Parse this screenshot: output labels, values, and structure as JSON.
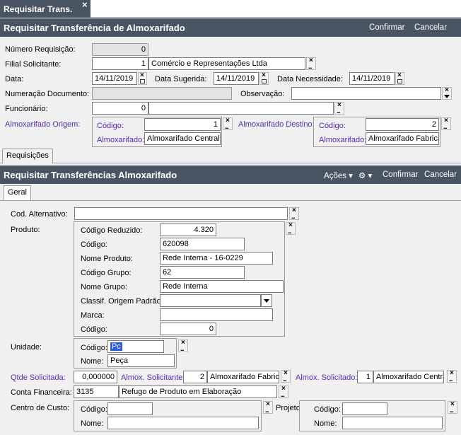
{
  "tab": {
    "label": "Requisitar Trans.",
    "close": "×"
  },
  "header1": {
    "title": "Requisitar Transferência de Almoxarifado",
    "confirm": "Confirmar",
    "cancel": "Cancelar"
  },
  "form": {
    "numero_requisicao": {
      "label": "Número Requisição:",
      "value": "0"
    },
    "filial": {
      "label": "Filial Solicitante:",
      "code": "1",
      "name": "Comércio e Representações Ltda"
    },
    "data": {
      "label": "Data:",
      "value": "14/11/2019"
    },
    "data_sugerida": {
      "label": "Data Sugerida:",
      "value": "14/11/2019"
    },
    "data_necessidade": {
      "label": "Data Necessidade:",
      "value": "14/11/2019"
    },
    "numeracao_documento": {
      "label": "Numeração Documento:",
      "value": ""
    },
    "observacao": {
      "label": "Observação:",
      "value": ""
    },
    "funcionario": {
      "label": "Funcionário:",
      "code": "0",
      "name": ""
    },
    "almox_origem": {
      "label": "Almoxarifado Origem:",
      "codigo_label": "Código:",
      "codigo": "1",
      "almox_label": "Almoxarifado:",
      "almox": "Almoxarifado Central"
    },
    "almox_destino": {
      "label": "Almoxarifado Destino:",
      "codigo_label": "Código:",
      "codigo": "2",
      "almox_label": "Almoxarifado:",
      "almox": "Almoxarifado Fabrica"
    }
  },
  "section_tab": "Requisições",
  "header2": {
    "title": "Requisitar Transferências Almoxarifado",
    "acoes": "Ações",
    "confirm": "Confirmar",
    "cancel": "Cancelar"
  },
  "geral_tab": "Geral",
  "item": {
    "cod_alternativo": {
      "label": "Cod. Alternativo:",
      "value": ""
    },
    "produto": {
      "label": "Produto:",
      "codigo_reduzido": {
        "label": "Código Reduzido:",
        "value": "4.320"
      },
      "codigo": {
        "label": "Código:",
        "value": "620098"
      },
      "nome_produto": {
        "label": "Nome Produto:",
        "value": "Rede Interna - 16-0229"
      },
      "codigo_grupo": {
        "label": "Código Grupo:",
        "value": "62"
      },
      "nome_grupo": {
        "label": "Nome Grupo:",
        "value": "Rede Interna"
      },
      "classif": {
        "label": "Classif. Origem Padrão:",
        "value": ""
      },
      "marca": {
        "label": "Marca:",
        "value": ""
      },
      "codigo2": {
        "label": "Código:",
        "value": "0"
      }
    },
    "unidade": {
      "label": "Unidade:",
      "codigo_label": "Código:",
      "codigo": "Pc",
      "nome_label": "Nome:",
      "nome": "Peça"
    },
    "qtde": {
      "label": "Qtde Solicitada:",
      "value": "0,000000"
    },
    "almox_solicitante": {
      "label": "Almox. Solicitante:",
      "code": "2",
      "name": "Almoxarifado Fabrica"
    },
    "almox_solicitado": {
      "label": "Almox. Solicitado:",
      "code": "1",
      "name": "Almoxarifado Central"
    },
    "conta": {
      "label": "Conta Financeira:",
      "code": "3135",
      "name": "Refugo de Produto em Elaboração"
    },
    "centro": {
      "label": "Centro de Custo:",
      "codigo_label": "Código:",
      "codigo": "",
      "nome_label": "Nome:",
      "nome": ""
    },
    "projeto": {
      "label": "Projeto:",
      "codigo_label": "Código:",
      "codigo": "",
      "nome_label": "Nome:",
      "nome": ""
    }
  },
  "icons": {
    "lookup_clear": "×",
    "lookup_search": "...",
    "dropdown": "▼",
    "gear": "⚙"
  },
  "colors": {
    "header": "#4a5563",
    "accent_label": "#5a2bb0",
    "selection": "#2a5bd7"
  }
}
